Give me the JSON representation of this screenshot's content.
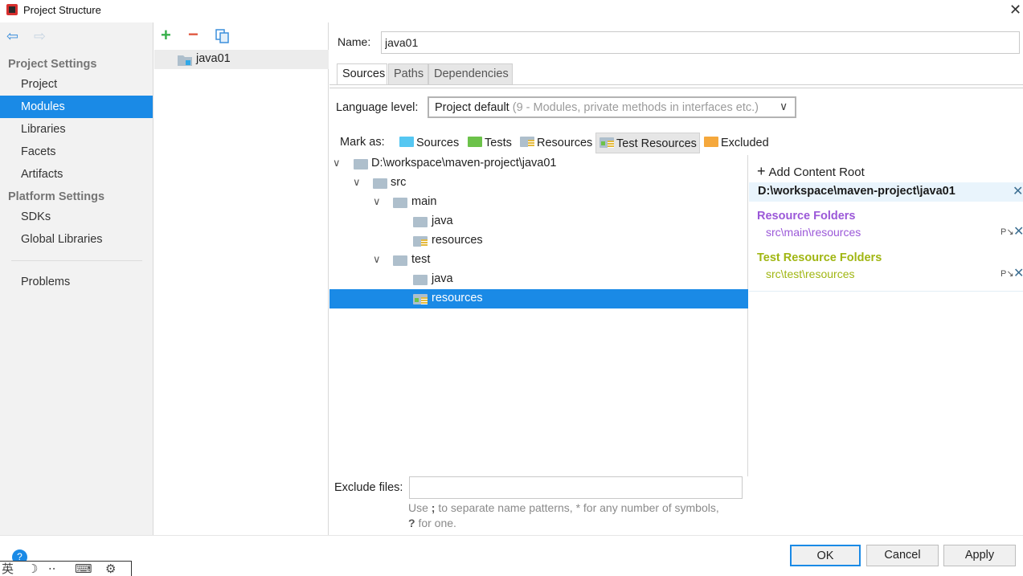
{
  "window": {
    "title": "Project Structure",
    "app_icon": "intellij-idea-icon",
    "close_glyph": "✕"
  },
  "nav": {
    "back_icon": "back-arrow-icon",
    "forward_icon": "forward-arrow-icon",
    "back_glyph": "⇦",
    "forward_glyph": "⇨"
  },
  "sidebar": {
    "project_settings_title": "Project Settings",
    "project_items": [
      {
        "label": "Project",
        "selected": false
      },
      {
        "label": "Modules",
        "selected": true
      },
      {
        "label": "Libraries",
        "selected": false
      },
      {
        "label": "Facets",
        "selected": false
      },
      {
        "label": "Artifacts",
        "selected": false
      }
    ],
    "platform_settings_title": "Platform Settings",
    "platform_items": [
      {
        "label": "SDKs"
      },
      {
        "label": "Global Libraries"
      }
    ],
    "problems_label": "Problems"
  },
  "modules": {
    "toolbar": {
      "add_glyph": "+",
      "remove_glyph": "−"
    },
    "list": [
      {
        "name": "java01",
        "selected": true
      }
    ]
  },
  "module": {
    "name_label": "Name:",
    "name_value": "java01",
    "tabs": [
      {
        "label": "Sources",
        "active": true
      },
      {
        "label": "Paths",
        "active": false
      },
      {
        "label": "Dependencies",
        "active": false
      }
    ],
    "language_level_label": "Language level:",
    "language_level_value": "Project default",
    "language_level_hint": "(9 - Modules, private methods in interfaces etc.)",
    "mark_as_label": "Mark as:",
    "mark_as_buttons": [
      {
        "label": "Sources",
        "color": "#55c7f2",
        "pressed": false
      },
      {
        "label": "Tests",
        "color": "#6cc24a",
        "pressed": false
      },
      {
        "label": "Resources",
        "color": "#aebfcc",
        "pressed": false
      },
      {
        "label": "Test Resources",
        "color": "#aebfcc",
        "pressed": true
      },
      {
        "label": "Excluded",
        "color": "#f5a83c",
        "pressed": false
      }
    ],
    "tree": [
      {
        "label": "D:\\workspace\\maven-project\\java01",
        "depth": 0,
        "expanded": true,
        "icon": "module-folder-icon",
        "selected": false
      },
      {
        "label": "src",
        "depth": 1,
        "expanded": true,
        "icon": "folder-icon",
        "selected": false
      },
      {
        "label": "main",
        "depth": 2,
        "expanded": true,
        "icon": "folder-icon",
        "selected": false
      },
      {
        "label": "java",
        "depth": 3,
        "expanded": null,
        "icon": "folder-icon",
        "selected": false
      },
      {
        "label": "resources",
        "depth": 3,
        "expanded": null,
        "icon": "resources-folder-icon",
        "selected": false
      },
      {
        "label": "test",
        "depth": 2,
        "expanded": true,
        "icon": "folder-icon",
        "selected": false
      },
      {
        "label": "java",
        "depth": 3,
        "expanded": null,
        "icon": "folder-icon",
        "selected": false
      },
      {
        "label": "resources",
        "depth": 3,
        "expanded": null,
        "icon": "test-resources-folder-icon",
        "selected": true
      }
    ],
    "exclude_files_label": "Exclude files:",
    "exclude_files_value": "",
    "exclude_hint_a": "Use ",
    "exclude_hint_sep": ";",
    "exclude_hint_b": " to separate name patterns, * for any number of symbols,",
    "exclude_hint_q": "?",
    "exclude_hint_c": " for one."
  },
  "content_root": {
    "add_label": "Add Content Root",
    "root_path": "D:\\workspace\\maven-project\\java01",
    "resource_folders_title": "Resource Folders",
    "resource_folders": [
      "src\\main\\resources"
    ],
    "test_resource_folders_title": "Test Resource Folders",
    "test_resource_folders": [
      "src\\test\\resources"
    ],
    "resource_color": "#9b58d8",
    "test_resource_color": "#a0b612"
  },
  "buttons": {
    "ok": "OK",
    "cancel": "Cancel",
    "apply": "Apply",
    "help": "?"
  },
  "ime_bar": {
    "glyph": "英"
  },
  "colors": {
    "selection": "#1a8ae6",
    "add_green": "#38b04b",
    "remove_red": "#e05a43"
  }
}
